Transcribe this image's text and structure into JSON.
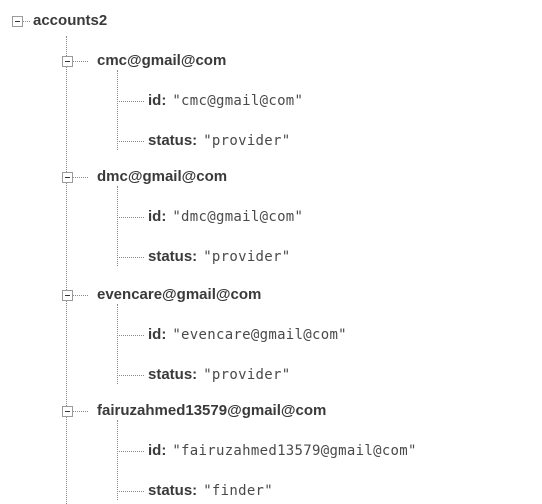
{
  "tree": {
    "root": {
      "key": "accounts2"
    },
    "children": [
      {
        "key": "cmc@gmail@com",
        "fields": [
          {
            "key": "id:",
            "value": "\"cmc@gmail@com\""
          },
          {
            "key": "status:",
            "value": "\"provider\""
          }
        ]
      },
      {
        "key": "dmc@gmail@com",
        "fields": [
          {
            "key": "id:",
            "value": "\"dmc@gmail@com\""
          },
          {
            "key": "status:",
            "value": "\"provider\""
          }
        ]
      },
      {
        "key": "evencare@gmail@com",
        "fields": [
          {
            "key": "id:",
            "value": "\"evencare@gmail@com\""
          },
          {
            "key": "status:",
            "value": "\"provider\""
          }
        ]
      },
      {
        "key": "fairuzahmed13579@gmail@com",
        "fields": [
          {
            "key": "id:",
            "value": "\"fairuzahmed13579@gmail@com\""
          },
          {
            "key": "status:",
            "value": "\"finder\""
          }
        ]
      }
    ]
  }
}
